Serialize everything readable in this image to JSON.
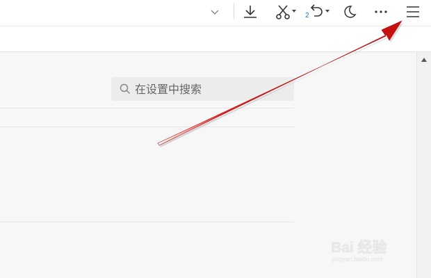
{
  "toolbar": {
    "dropdown_icon": "chevron-down-icon",
    "download_icon": "download-icon",
    "cut_icon": "scissors-icon",
    "undo_icon": "undo-icon",
    "undo_count": "2",
    "night_mode_icon": "moon-icon",
    "more_icon": "more-dots-icon",
    "menu_icon": "hamburger-menu-icon"
  },
  "settings": {
    "search_placeholder": "在设置中搜索"
  },
  "scrollbar": {
    "up_icon": "scroll-up-arrow-icon"
  },
  "annotation": {
    "arrow_color": "#e21b1b",
    "target": "menu-button"
  },
  "watermark": {
    "brand_text": "Bai 经验",
    "sub_text": "jingyan.baidu.com"
  },
  "colors": {
    "accent_blue": "#1a7bd0",
    "arrow_red": "#e21b1b"
  }
}
